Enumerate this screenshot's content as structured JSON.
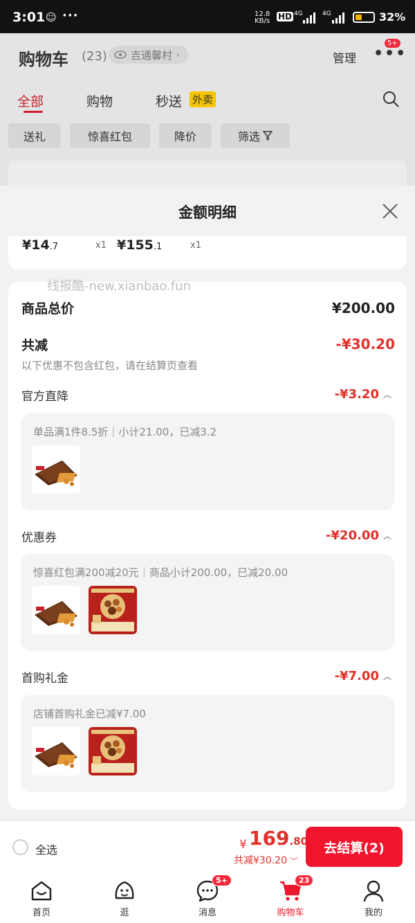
{
  "status_bar": {
    "time": "3:01",
    "dots": "···",
    "speed_top": "12.8",
    "speed_bottom": "KB/s",
    "hd": "HD",
    "signal1": "4G",
    "signal2": "4G",
    "battery": "32%"
  },
  "cart_header": {
    "title": "购物车",
    "count": "(23)",
    "address": "吉通馨村",
    "manage": "管理",
    "more_badge": "5+",
    "tabs": {
      "all": "全部",
      "shop": "购物",
      "fast": "秒送",
      "takeout": "外卖"
    },
    "chips": {
      "gift": "送礼",
      "redpacket": "惊喜红包",
      "price_drop": "降价",
      "filter": "筛选"
    }
  },
  "sheet": {
    "title": "金额明细",
    "items": [
      {
        "price_main": "¥14",
        "price_dec": ".7",
        "qty": "x1"
      },
      {
        "price_main": "¥155",
        "price_dec": ".1",
        "qty": "x1"
      }
    ],
    "watermark": "线报酷-new.xianbao.fun",
    "total_label": "商品总价",
    "total_value": "¥200.00",
    "discount_label": "共减",
    "discount_value": "-¥30.20",
    "discount_note": "以下优惠不包含红包，请在结算页查看",
    "sections": [
      {
        "label": "官方直降",
        "value": "-¥3.20",
        "detail": "单品满1件8.5折｜小计21.00，已减3.2"
      },
      {
        "label": "优惠券",
        "value": "-¥20.00",
        "detail": "惊喜红包满200减20元｜商品小计200.00，已减20.00"
      },
      {
        "label": "首购礼金",
        "value": "-¥7.00",
        "detail": "店铺首购礼金已减¥7.00"
      }
    ]
  },
  "bottom_bar": {
    "select_all": "全选",
    "yen": "¥",
    "total_main": "169",
    "total_dec": ".80",
    "discount": "共减¥30.20",
    "checkout": "去结算(2)"
  },
  "tab_bar": {
    "items": [
      {
        "label": "首页",
        "icon": "home-icon"
      },
      {
        "label": "逛",
        "icon": "browse-icon"
      },
      {
        "label": "消息",
        "icon": "message-icon",
        "badge": "5+"
      },
      {
        "label": "购物车",
        "icon": "cart-icon",
        "badge": "23",
        "active": true
      },
      {
        "label": "我的",
        "icon": "profile-icon"
      }
    ]
  },
  "colors": {
    "accent_red": "#e0312a",
    "checkout_red": "#f0152c",
    "takeout_yellow": "#f5c400"
  }
}
